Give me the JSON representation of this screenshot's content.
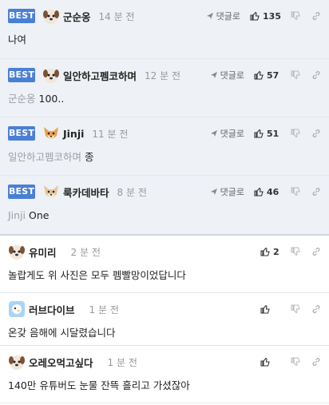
{
  "comments": [
    {
      "best": "BEST",
      "nick": "군순옹",
      "time": "14 분 전",
      "reply": "댓글로",
      "likes": "135",
      "mention": "",
      "text": "나여"
    },
    {
      "best": "BEST",
      "nick": "일안하고펨코하며",
      "time": "12 분 전",
      "reply": "댓글로",
      "likes": "57",
      "mention": "군순옹",
      "text": "100.."
    },
    {
      "best": "BEST",
      "nick": "Jinji",
      "time": "11 분 전",
      "reply": "댓글로",
      "likes": "51",
      "mention": "일안하고펨코하며",
      "text": "종"
    },
    {
      "best": "BEST",
      "nick": "룩카데바타",
      "time": "8 분 전",
      "reply": "댓글로",
      "likes": "46",
      "mention": "Jinji",
      "text": "One"
    },
    {
      "nick": "유미리",
      "time": "2 분 전",
      "likes": "2",
      "text": "놀랍게도 위 사진은 모두 펨빨망이었답니다"
    },
    {
      "nick": "러브다이브",
      "time": "1 분 전",
      "likes": "",
      "text": "온갖 음해에 시달렸습니다"
    },
    {
      "nick": "오레오먹고싶다",
      "time": "1 분 전",
      "likes": "",
      "text": "140만 유튜버도 눈물 잔뜩 흘리고 가셨잖아"
    }
  ],
  "icons": {
    "reply": "reply-arrow-icon",
    "like": "thumbs-up-icon",
    "dislike": "thumbs-down-icon",
    "link": "link-icon"
  },
  "colors": {
    "best_badge": "#4a7fd6",
    "best_row_bg": "#eef1f6"
  }
}
